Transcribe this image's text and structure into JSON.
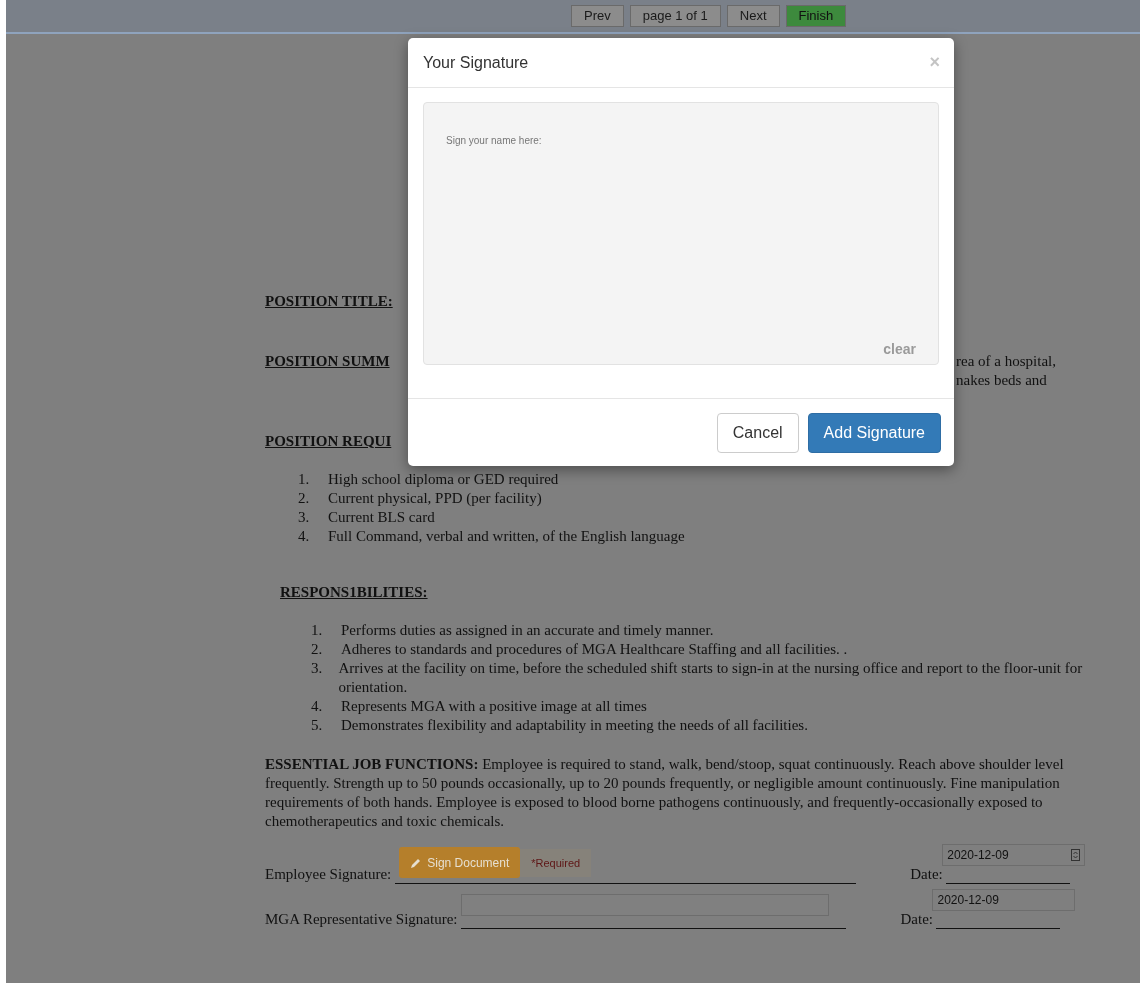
{
  "toolbar": {
    "prev": "Prev",
    "page": "page 1 of 1",
    "next": "Next",
    "finish": "Finish"
  },
  "document": {
    "position_title": "POSITION TITLE:",
    "position_summary": {
      "heading": "POSITION SUMM",
      "lines": [
        "rea of a hospital,",
        "nakes beds and"
      ]
    },
    "position_requirements": {
      "heading": "POSITION REQUI",
      "items": [
        {
          "number": "1.",
          "text": "High school diploma or GED required"
        },
        {
          "number": "2.",
          "text": "Current physical, PPD (per facility)"
        },
        {
          "number": "3.",
          "text": "Current BLS card"
        },
        {
          "number": "4.",
          "text": "Full Command, verbal and written, of the English language"
        }
      ]
    },
    "responsibilities": {
      "heading": "RESPONS1BILITIES:",
      "items": [
        {
          "number": "1.",
          "text": "Performs duties as assigned in an accurate and timely manner."
        },
        {
          "number": "2.",
          "text": "Adheres to standards and procedures of MGA Healthcare Staffing and all facilities. ."
        },
        {
          "number": "3.",
          "text": "Arrives at the facility on time, before the scheduled shift starts to sign-in at the nursing office and report to the floor-unit for orientation."
        },
        {
          "number": "4.",
          "text": "Represents MGA with a positive image at all times"
        },
        {
          "number": "5.",
          "text": "Demonstrates flexibility and adaptability in meeting the needs of all facilities."
        }
      ]
    },
    "essential": "**ESSENTIAL JOB FUNCTIONS:** Employee is required to stand, walk, bend/stoop, squat continuously. Reach above shoulder level frequently. Strength up to 50 pounds occasionally, up to 20 pounds frequently, or negligible amount continuously. Fine manipulation requirements of both hands. Employee is exposed to blood borne pathogens continuously, and frequently-occasionally exposed to chemotherapeutics and toxic chemicals.",
    "signatures": [
      {
        "kind": "button",
        "label": "Employee Signature:",
        "button": "Sign Document",
        "required": "*Required",
        "date_label": "Date:",
        "date_value": "2020-12-09",
        "spinner": true
      },
      {
        "kind": "field",
        "label": "MGA Representative Signature:",
        "date_label": "Date:",
        "date_value": "2020-12-09",
        "spinner": false
      }
    ]
  },
  "modal": {
    "title": "Your Signature",
    "close": "×",
    "prompt": "Sign your name here:",
    "clear": "clear",
    "buttons": [
      {
        "label": "Cancel",
        "kind": "default"
      },
      {
        "label": "Add Signature",
        "kind": "primary"
      }
    ]
  }
}
